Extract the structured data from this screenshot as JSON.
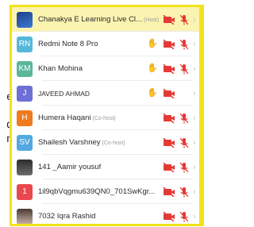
{
  "background_fragments": [
    "e",
    "d",
    "n"
  ],
  "participants": [
    {
      "initials": "",
      "avatar_color": "#2857b8",
      "name": "Chanakya E Learning Live Cl...",
      "tag": "(Host)",
      "hand_raised": false
    },
    {
      "initials": "RN",
      "avatar_color": "#56b8d8",
      "name": "Redmi Note 8 Pro",
      "tag": "",
      "hand_raised": true
    },
    {
      "initials": "KM",
      "avatar_color": "#5bb79a",
      "name": "Khan Mohina",
      "tag": "",
      "hand_raised": true
    },
    {
      "initials": "J",
      "avatar_color": "#6d6fd6",
      "name": "JAVEED AHMAD",
      "tag": "",
      "hand_raised": true
    },
    {
      "initials": "H",
      "avatar_color": "#f07a1e",
      "name": "Humera Haqani",
      "tag": "(Co-host)",
      "hand_raised": false
    },
    {
      "initials": "SV",
      "avatar_color": "#52a8e0",
      "name": "Shailesh Varshney",
      "tag": "(Co-host)",
      "hand_raised": false
    },
    {
      "initials": "",
      "avatar_color": "#333333",
      "name": "141 _Aamir yousuf",
      "tag": "",
      "hand_raised": false
    },
    {
      "initials": "1",
      "avatar_color": "#e8484e",
      "name": "1il9qbVqgmu639QN0_701SwKgr...",
      "tag": "",
      "hand_raised": false
    },
    {
      "initials": "",
      "avatar_color": "#7a6358",
      "name": "7032 Iqra Rashid",
      "tag": "",
      "hand_raised": false
    }
  ],
  "colors": {
    "muted_icon": "#e53935",
    "hand": "#f5b400",
    "highlight_border": "#f2e21a"
  }
}
